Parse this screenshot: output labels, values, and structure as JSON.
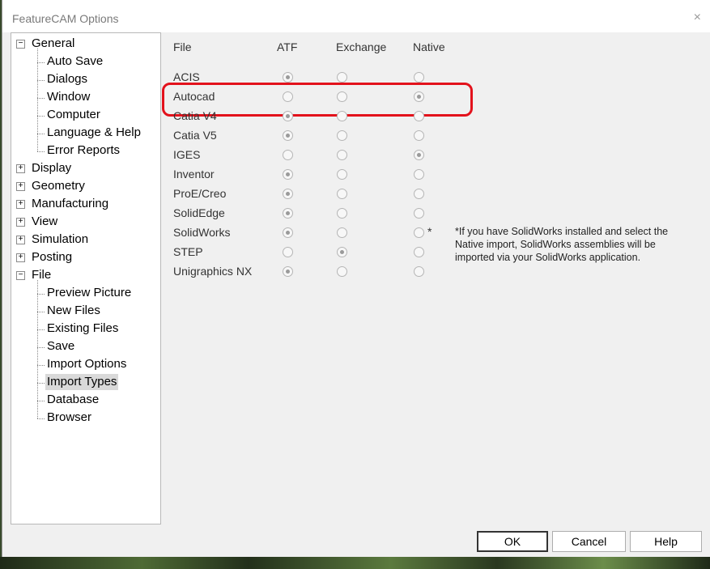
{
  "window": {
    "title": "FeatureCAM Options",
    "close_label": "×"
  },
  "tree": {
    "general": {
      "label": "General",
      "expander": "−",
      "children": [
        "Auto Save",
        "Dialogs",
        "Window",
        "Computer",
        "Language & Help",
        "Error Reports"
      ]
    },
    "collapsed": [
      {
        "label": "Display",
        "expander": "+"
      },
      {
        "label": "Geometry",
        "expander": "+"
      },
      {
        "label": "Manufacturing",
        "expander": "+"
      },
      {
        "label": "View",
        "expander": "+"
      },
      {
        "label": "Simulation",
        "expander": "+"
      },
      {
        "label": "Posting",
        "expander": "+"
      }
    ],
    "file": {
      "label": "File",
      "expander": "−",
      "children": [
        "Preview Picture",
        "New Files",
        "Existing Files",
        "Save",
        "Import Options",
        "Import Types",
        "Database",
        "Browser"
      ],
      "selected": "Import Types"
    }
  },
  "import_types": {
    "headers": {
      "file": "File",
      "atf": "ATF",
      "exchange": "Exchange",
      "native": "Native"
    },
    "rows": [
      {
        "name": "ACIS",
        "selected": "atf"
      },
      {
        "name": "Autocad",
        "selected": "native"
      },
      {
        "name": "Catia V4",
        "selected": "atf"
      },
      {
        "name": "Catia V5",
        "selected": "atf"
      },
      {
        "name": "IGES",
        "selected": "native"
      },
      {
        "name": "Inventor",
        "selected": "atf"
      },
      {
        "name": "ProE/Creo",
        "selected": "atf"
      },
      {
        "name": "SolidEdge",
        "selected": "atf"
      },
      {
        "name": "SolidWorks",
        "selected": "atf"
      },
      {
        "name": "STEP",
        "selected": "exchange"
      },
      {
        "name": "Unigraphics NX",
        "selected": "atf"
      }
    ],
    "solidworks_marker": "*",
    "note": "*If you have SolidWorks installed and select the Native import, SolidWorks assemblies will be imported via your SolidWorks application."
  },
  "buttons": {
    "ok": "OK",
    "cancel": "Cancel",
    "help": "Help"
  },
  "colors": {
    "highlight": "#e3121c",
    "selection": "#d9d9d9"
  }
}
